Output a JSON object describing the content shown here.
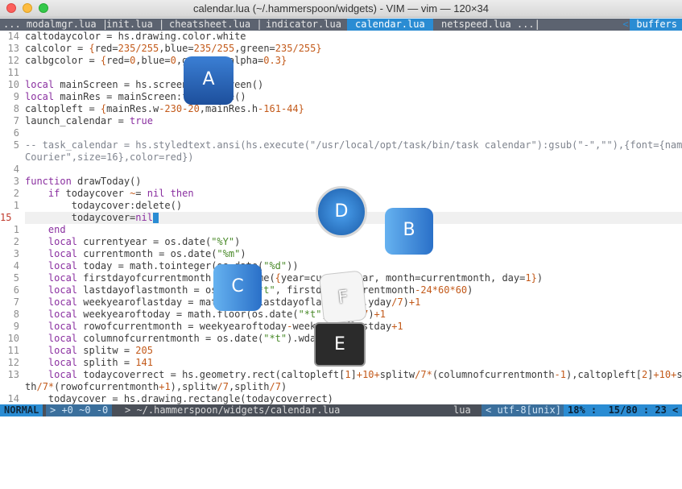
{
  "window": {
    "title": "calendar.lua (~/.hammerspoon/widgets) - VIM — vim — 120×34"
  },
  "tabline": {
    "tabs": [
      {
        "label": "... modalmgr.lua |",
        "selected": false
      },
      {
        "label": "init.lua |",
        "selected": false
      },
      {
        "label": "cheatsheet.lua |",
        "selected": false
      },
      {
        "label": "indicator.lua",
        "selected": false
      },
      {
        "label": "calendar.lua",
        "selected": true
      },
      {
        "label": "netspeed.lua ...|",
        "selected": false
      }
    ],
    "buffers_label": "buffers",
    "buffers_arrow": "<"
  },
  "code_lines": [
    {
      "n": "14",
      "t": "caltodaycolor = hs.drawing.color.white"
    },
    {
      "n": "13",
      "t": "calcolor = {red=235/255,blue=235/255,green=235/255}"
    },
    {
      "n": "12",
      "t": "calbgcolor = {red=0,blue=0,green=0,alpha=0.3}"
    },
    {
      "n": "11",
      "t": ""
    },
    {
      "n": "10",
      "t": "local mainScreen = hs.screen.mainScreen()"
    },
    {
      "n": "9",
      "t": "local mainRes = mainScreen:fullFrame()"
    },
    {
      "n": "8",
      "t": "caltopleft = {mainRes.w-230-20,mainRes.h-161-44}"
    },
    {
      "n": "7",
      "t": "launch_calendar = true"
    },
    {
      "n": "6",
      "t": ""
    },
    {
      "n": "5",
      "t": "-- task_calendar = hs.styledtext.ansi(hs.execute(\"/usr/local/opt/task/bin/task calendar\"):gsub(\"-\",\"\"),{font={name=\""
    },
    {
      "n": "",
      "t": "Courier\",size=16},color=red})"
    },
    {
      "n": "4",
      "t": ""
    },
    {
      "n": "3",
      "t": "function drawToday()"
    },
    {
      "n": "2",
      "t": "    if todaycover ~= nil then"
    },
    {
      "n": "1",
      "t": "        todaycover:delete()"
    },
    {
      "n": "15",
      "t": "        todaycover=nil",
      "current": true
    },
    {
      "n": "1",
      "t": "    end"
    },
    {
      "n": "2",
      "t": "    local currentyear = os.date(\"%Y\")"
    },
    {
      "n": "3",
      "t": "    local currentmonth = os.date(\"%m\")"
    },
    {
      "n": "4",
      "t": "    local today = math.tointeger(os.date(\"%d\"))"
    },
    {
      "n": "5",
      "t": "    local firstdayofcurrentmonth = os.time({year=currentyear, month=currentmonth, day=1})"
    },
    {
      "n": "6",
      "t": "    local lastdayoflastmonth = os.date(\"*t\", firstdayofcurrentmonth-24*60*60)"
    },
    {
      "n": "7",
      "t": "    local weekyearoflastday = math.ceil(lastdayoflastmonth.yday/7)+1"
    },
    {
      "n": "8",
      "t": "    local weekyearoftoday = math.floor(os.date(\"*t\").yday/7)+1"
    },
    {
      "n": "9",
      "t": "    local rowofcurrentmonth = weekyearoftoday-weekyearoflastday+1"
    },
    {
      "n": "10",
      "t": "    local columnofcurrentmonth = os.date(\"*t\").wday"
    },
    {
      "n": "11",
      "t": "    local splitw = 205"
    },
    {
      "n": "12",
      "t": "    local splith = 141"
    },
    {
      "n": "13",
      "t": "    local todaycoverrect = hs.geometry.rect(caltopleft[1]+10+splitw/7*(columnofcurrentmonth-1),caltopleft[2]+10+spli"
    },
    {
      "n": "",
      "t": "th/7*(rowofcurrentmonth+1),splitw/7,splith/7)"
    },
    {
      "n": "14",
      "t": "    todaycover = hs.drawing.rectangle(todaycoverrect)"
    }
  ],
  "statusline": {
    "mode": "NORMAL",
    "git": "> +0 ~0 -0",
    "file": "> ~/.hammerspoon/widgets/calendar.lua",
    "filetype": "lua",
    "encoding": "< utf-8[unix] <",
    "position": "18% :  15/80 : 23 <"
  },
  "app_switcher": [
    {
      "letter": "A",
      "app": "Xcode-like",
      "icon": "a-app-icon"
    },
    {
      "letter": "B",
      "app": "Finder",
      "icon": "b-app-icon"
    },
    {
      "letter": "C",
      "app": "Finder",
      "icon": "c-app-icon"
    },
    {
      "letter": "D",
      "app": "Safari",
      "icon": "d-app-icon"
    },
    {
      "letter": "E",
      "app": "Terminal",
      "icon": "e-app-icon"
    },
    {
      "letter": "F",
      "app": "TextEdit",
      "icon": "f-app-icon"
    }
  ],
  "colors": {
    "accent": "#2a8cd3",
    "keyword": "#8a2fa0",
    "number": "#c35a1a",
    "string": "#4a8a2a",
    "cursor_line_nr": "#c0392b"
  }
}
